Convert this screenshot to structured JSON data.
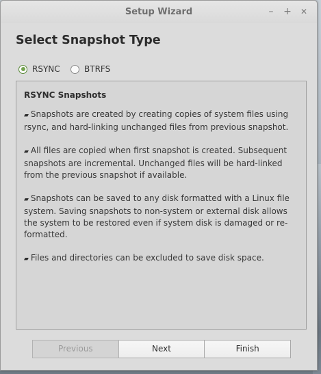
{
  "window": {
    "title": "Setup Wizard",
    "controls": {
      "minimize": "–",
      "maximize": "+",
      "close": "✕"
    }
  },
  "heading": "Select Snapshot Type",
  "snapshot_types": [
    {
      "label": "RSYNC",
      "selected": true
    },
    {
      "label": "BTRFS",
      "selected": false
    }
  ],
  "panel": {
    "title": "RSYNC Snapshots",
    "bullet_glyph": "▰",
    "paragraphs": [
      "Snapshots are created by creating copies of system files using rsync, and hard-linking unchanged files from previous snapshot.",
      "All files are copied when first snapshot is created. Subsequent snapshots are incremental. Unchanged files will be hard-linked from the previous snapshot if available.",
      "Snapshots can be saved to any disk formatted with a Linux file system. Saving snapshots to non-system or external disk allows the system to be restored even if system disk is damaged or re-formatted.",
      "Files and directories can be excluded to save disk space."
    ]
  },
  "buttons": {
    "previous": "Previous",
    "next": "Next",
    "finish": "Finish"
  },
  "colors": {
    "radio_selected": "#74a34f",
    "window_bg": "#dcdcdc"
  }
}
